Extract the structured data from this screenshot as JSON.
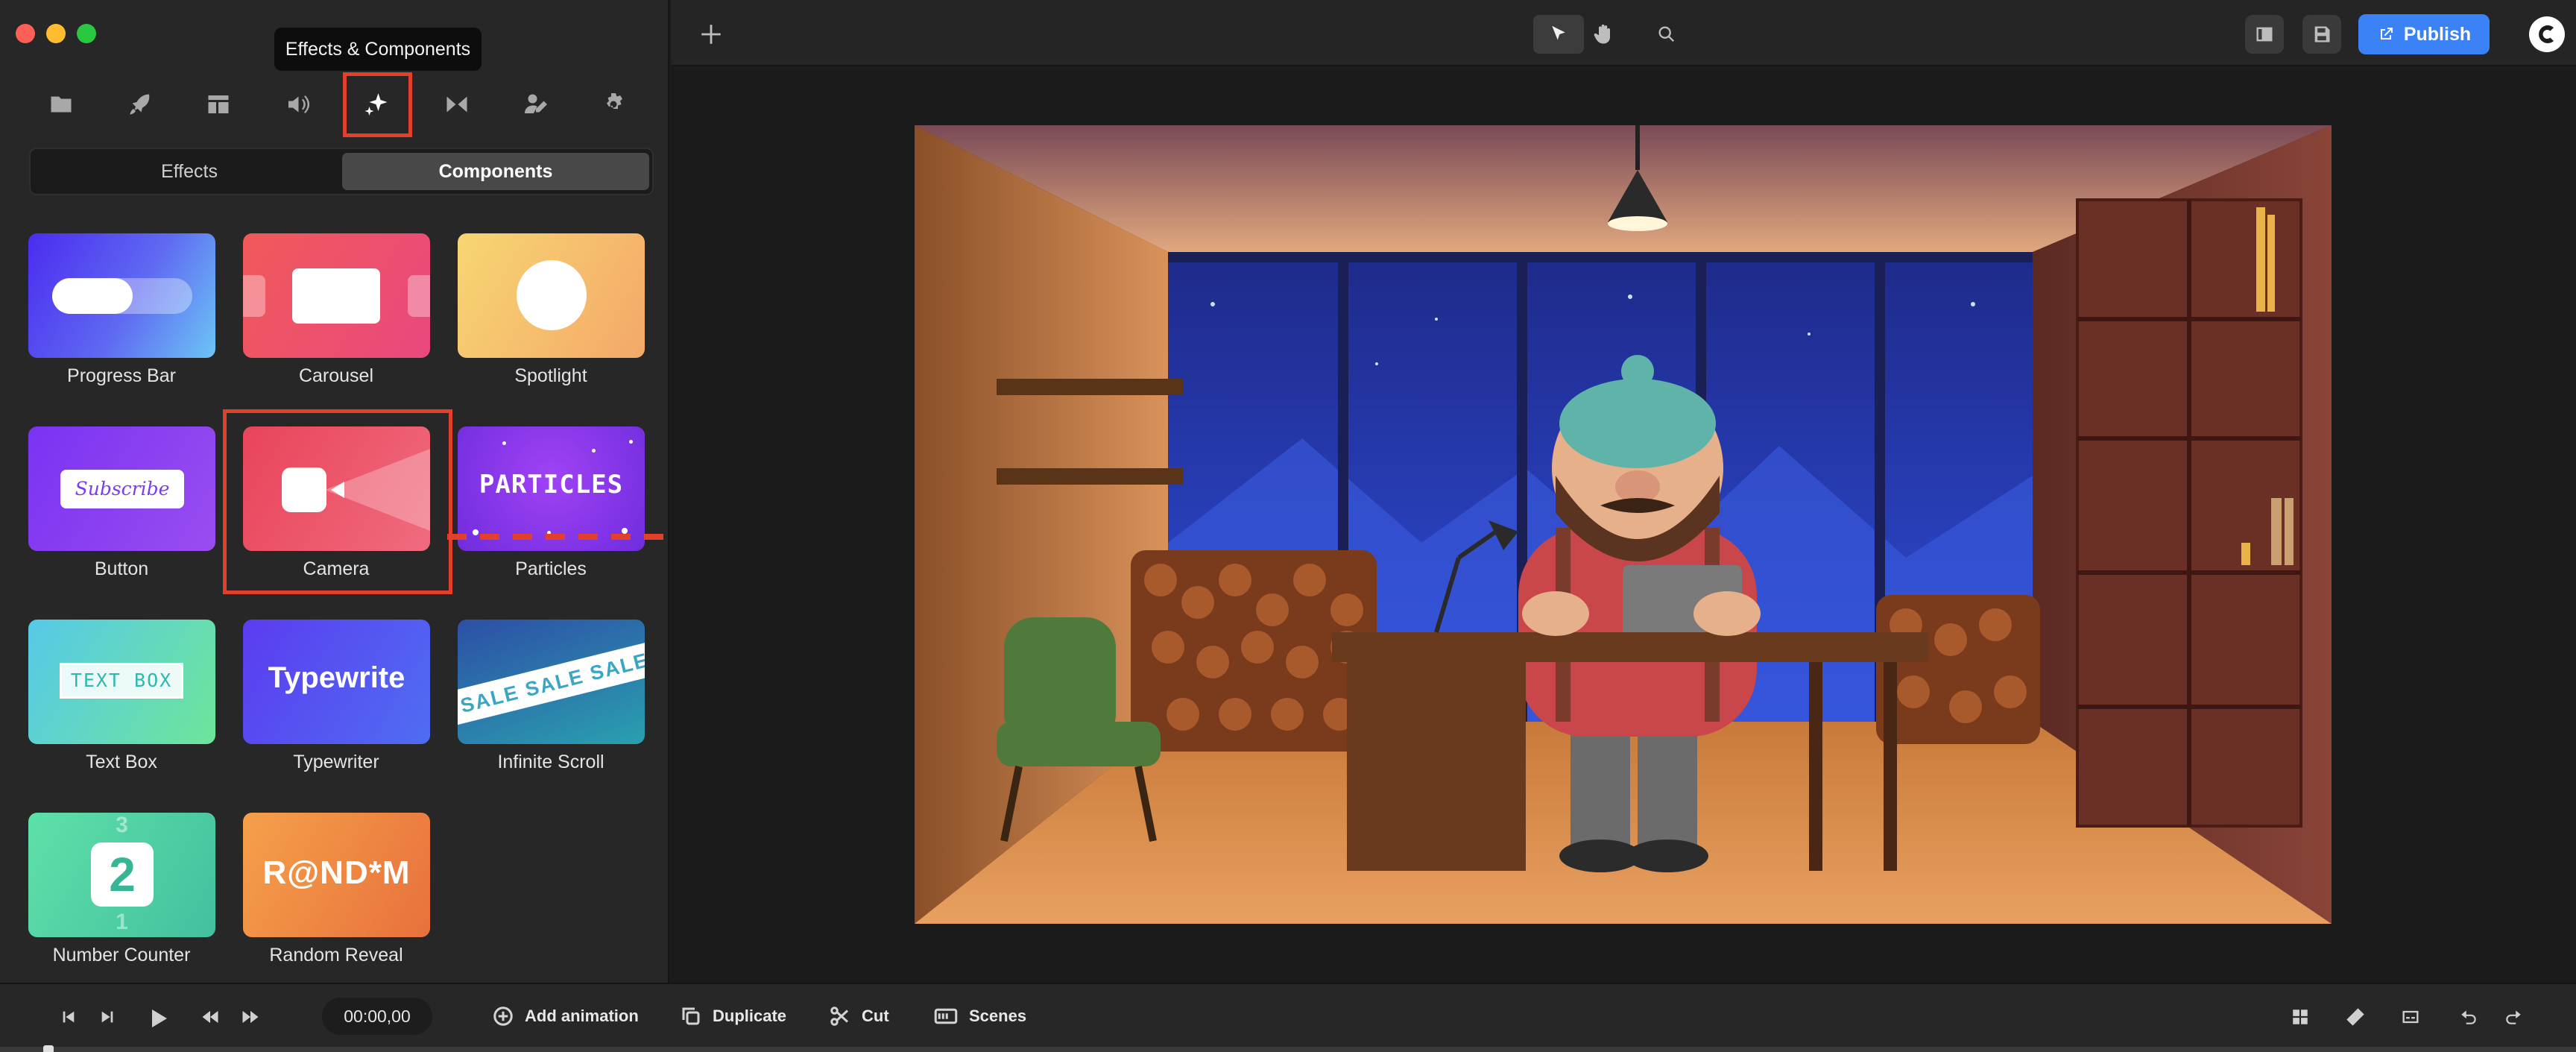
{
  "tooltip": "Effects & Components",
  "sidebar": {
    "top_icons": [
      {
        "name": "folder-icon"
      },
      {
        "name": "rocket-icon"
      },
      {
        "name": "layout-icon"
      },
      {
        "name": "speaker-icon"
      },
      {
        "name": "sparkles-icon",
        "active": true
      },
      {
        "name": "transition-icon"
      },
      {
        "name": "user-edit-icon"
      },
      {
        "name": "gear-icon"
      }
    ],
    "tabs": {
      "effects": "Effects",
      "components": "Components",
      "selected": "Components"
    },
    "components": [
      {
        "id": "progress-bar",
        "label": "Progress Bar"
      },
      {
        "id": "carousel",
        "label": "Carousel"
      },
      {
        "id": "spotlight",
        "label": "Spotlight"
      },
      {
        "id": "button",
        "label": "Button",
        "art_text": "Subscribe"
      },
      {
        "id": "camera",
        "label": "Camera"
      },
      {
        "id": "particles",
        "label": "Particles",
        "art_text": "PARTICLES"
      },
      {
        "id": "text-box",
        "label": "Text Box",
        "art_text": "TEXT BOX"
      },
      {
        "id": "typewriter",
        "label": "Typewriter",
        "art_text": "Typewrite"
      },
      {
        "id": "infinite-scroll",
        "label": "Infinite Scroll",
        "art_text": "SALE SALE SALE"
      },
      {
        "id": "number-counter",
        "label": "Number Counter",
        "art_text": "2",
        "art_ghost_top": "3",
        "art_ghost_bottom": "1"
      },
      {
        "id": "random-reveal",
        "label": "Random Reveal",
        "art_text": "R@ND*M"
      }
    ]
  },
  "topbar": {
    "add_icon": "plus-icon",
    "tools": [
      "cursor-icon",
      "hand-icon",
      "search-icon"
    ],
    "right_icons": [
      "sidebar-toggle-icon",
      "save-icon"
    ],
    "publish_label": "Publish",
    "avatar_icon": "brand-logo-icon"
  },
  "canvas": {
    "scene_description_hidden": true
  },
  "bottombar": {
    "transport": [
      "skip-start-icon",
      "step-forward-icon",
      "play-icon",
      "rewind-icon",
      "fast-forward-icon"
    ],
    "timecode": "00:00,00",
    "actions": {
      "add_animation": "Add animation",
      "duplicate": "Duplicate",
      "cut": "Cut",
      "scenes": "Scenes"
    },
    "right_icons": [
      "grid-icon",
      "ruler-icon",
      "captions-icon",
      "undo-icon",
      "redo-icon"
    ]
  },
  "colors": {
    "accent": "#3b82f6",
    "highlight": "#e2402a",
    "panel": "#272727"
  }
}
